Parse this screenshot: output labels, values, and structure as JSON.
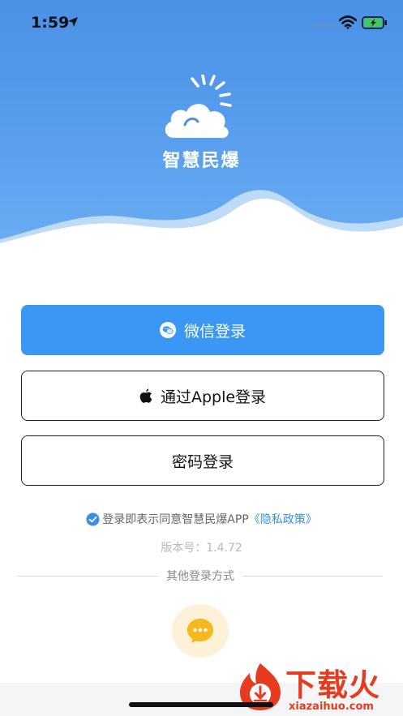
{
  "status_bar": {
    "time": "1:59"
  },
  "app": {
    "name": "智慧民爆"
  },
  "buttons": {
    "wechat": "微信登录",
    "apple": "通过Apple登录",
    "password": "密码登录"
  },
  "agreement": {
    "text": "登录即表示同意智慧民爆APP",
    "link": "《隐私政策》"
  },
  "version": {
    "label": "版本号：",
    "value": "1.4.72"
  },
  "other_login": {
    "label": "其他登录方式"
  },
  "watermark": {
    "brand": "下载火",
    "domain": "xiazaihuo.com"
  },
  "colors": {
    "primary": "#3a97f3",
    "hero_blue": "#4a90e6",
    "link": "#3a8ee6",
    "other_button_bg": "#fdf1d8",
    "other_button_icon": "#f7b71d",
    "watermark": "#e63b1f"
  }
}
